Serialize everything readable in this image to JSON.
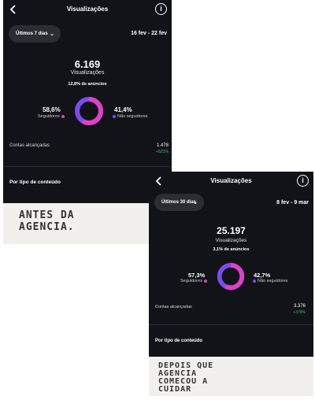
{
  "before": {
    "header": {
      "title": "Visualizações"
    },
    "filter_label": "Últimos 7 dias",
    "date_range": "16 fev - 22 fev",
    "total": "6.169",
    "total_label": "Visualizações",
    "ads_note": "12,8% de anúncios",
    "followers_pct": "58,6%",
    "followers_label": "Seguidores",
    "followers_fraction": 0.586,
    "nonfollowers_pct": "41,4%",
    "nonfollowers_label": "Não seguidores",
    "reach_label": "Contas alcançadas",
    "reach_value": "1.478",
    "reach_delta": "+521%",
    "content_type_label": "Por tipo de conteúdo",
    "caption": [
      "ANTES DA",
      "AGENCIA."
    ]
  },
  "after": {
    "header": {
      "title": "Visualizações"
    },
    "filter_label": "Últimos 30 dias",
    "date_range": "8 fev - 9 mar",
    "total": "25.197",
    "total_label": "Visualizações",
    "ads_note": "3,1% de anúncios",
    "followers_pct": "57,3%",
    "followers_label": "Seguidores",
    "followers_fraction": 0.573,
    "nonfollowers_pct": "42,7%",
    "nonfollowers_label": "Não seguidores",
    "reach_label": "Contas alcançadas",
    "reach_value": "3.376",
    "reach_delta": "+379%",
    "content_type_label": "Por tipo de conteúdo",
    "caption": [
      "DEPOIS QUE",
      "AGENCIA",
      "COMECOU A",
      "CUIDAR"
    ]
  },
  "colors": {
    "followers": "#e040c8",
    "nonfollowers": "#7a4cf0",
    "positive_delta": "#3ec46d",
    "panel_bg": "#111318"
  },
  "icons": {
    "back": "chevron-left-icon",
    "info": "info-circle-icon",
    "dropdown": "chevron-down-icon"
  }
}
